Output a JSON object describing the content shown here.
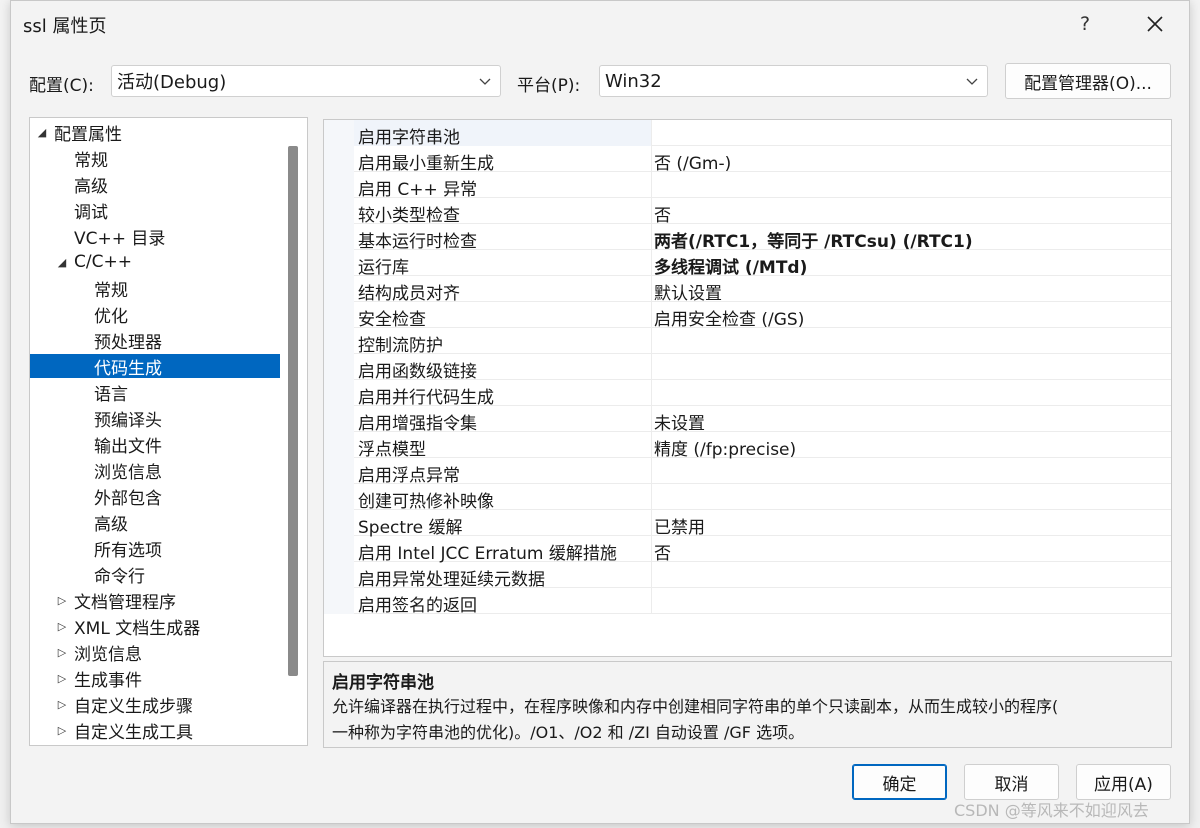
{
  "window": {
    "title": "ssl 属性页",
    "help": "?",
    "close_icon": "close-icon"
  },
  "toolbar": {
    "config_label": "配置(C):",
    "config_value": "活动(Debug)",
    "platform_label": "平台(P):",
    "platform_value": "Win32",
    "config_manager_button": "配置管理器(O)..."
  },
  "tree": {
    "items": [
      {
        "label": "配置属性",
        "arrow": "expanded"
      },
      {
        "label": "常规"
      },
      {
        "label": "高级"
      },
      {
        "label": "调试"
      },
      {
        "label": "VC++ 目录"
      },
      {
        "label": "C/C++",
        "arrow": "expanded"
      },
      {
        "label": "常规"
      },
      {
        "label": "优化"
      },
      {
        "label": "预处理器"
      },
      {
        "label": "代码生成",
        "selected": true
      },
      {
        "label": "语言"
      },
      {
        "label": "预编译头"
      },
      {
        "label": "输出文件"
      },
      {
        "label": "浏览信息"
      },
      {
        "label": "外部包含"
      },
      {
        "label": "高级"
      },
      {
        "label": "所有选项"
      },
      {
        "label": "命令行"
      },
      {
        "label": "文档管理程序",
        "arrow": "collapsed"
      },
      {
        "label": "XML 文档生成器",
        "arrow": "collapsed"
      },
      {
        "label": "浏览信息",
        "arrow": "collapsed"
      },
      {
        "label": "生成事件",
        "arrow": "collapsed"
      },
      {
        "label": "自定义生成步骤",
        "arrow": "collapsed"
      },
      {
        "label": "自定义生成工具",
        "arrow": "collapsed"
      }
    ]
  },
  "properties": {
    "rows": [
      {
        "name": "启用字符串池",
        "value": ""
      },
      {
        "name": "启用最小重新生成",
        "value": "否 (/Gm-)"
      },
      {
        "name": "启用 C++ 异常",
        "value": ""
      },
      {
        "name": "较小类型检查",
        "value": "否"
      },
      {
        "name": "基本运行时检查",
        "value": "两者(/RTC1，等同于 /RTCsu) (/RTC1)",
        "bold": true
      },
      {
        "name": "运行库",
        "value": "多线程调试 (/MTd)",
        "bold": true
      },
      {
        "name": "结构成员对齐",
        "value": "默认设置"
      },
      {
        "name": "安全检查",
        "value": "启用安全检查 (/GS)"
      },
      {
        "name": "控制流防护",
        "value": ""
      },
      {
        "name": "启用函数级链接",
        "value": ""
      },
      {
        "name": "启用并行代码生成",
        "value": ""
      },
      {
        "name": "启用增强指令集",
        "value": "未设置"
      },
      {
        "name": "浮点模型",
        "value": "精度 (/fp:precise)"
      },
      {
        "name": "启用浮点异常",
        "value": ""
      },
      {
        "name": "创建可热修补映像",
        "value": ""
      },
      {
        "name": "Spectre 缓解",
        "value": "已禁用"
      },
      {
        "name": "启用 Intel JCC Erratum 缓解措施",
        "value": "否"
      },
      {
        "name": "启用异常处理延续元数据",
        "value": ""
      },
      {
        "name": "启用签名的返回",
        "value": ""
      }
    ]
  },
  "description": {
    "title": "启用字符串池",
    "line1": "允许编译器在执行过程中，在程序映像和内存中创建相同字符串的单个只读副本，从而生成较小的程序(",
    "line2": "一种称为字符串池的优化)。/O1、/O2 和 /ZI 自动设置 /GF 选项。"
  },
  "footer": {
    "ok": "确定",
    "cancel": "取消",
    "apply": "应用(A)"
  },
  "watermark": "CSDN @等风来不如迎风去"
}
